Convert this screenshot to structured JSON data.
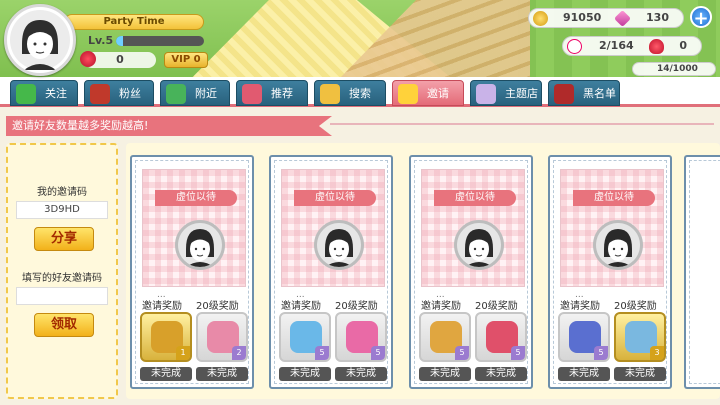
{
  "player": {
    "name": "Party Time",
    "level": "Lv.5",
    "level_progress": 0.08,
    "roses": "0",
    "vip_label": "VIP 0"
  },
  "currency": {
    "coins": "91050",
    "gems": "130",
    "friends": "2/164",
    "hearts": "0",
    "plus_label": "+",
    "partial": "14/1000"
  },
  "tabs": [
    {
      "label": "关注",
      "icon": "follow-arrow-icon",
      "color": "#45b84a"
    },
    {
      "label": "粉丝",
      "icon": "fan-avatar-icon",
      "color": "#c0392b"
    },
    {
      "label": "附近",
      "icon": "map-pin-icon",
      "color": "#48b35a"
    },
    {
      "label": "推荐",
      "icon": "recommend-heart-icon",
      "color": "#e15a70"
    },
    {
      "label": "搜索",
      "icon": "magnifier-icon",
      "color": "#f0c040"
    },
    {
      "label": "邀请",
      "icon": "invite-user-plus-icon",
      "color": "#ffd23a"
    },
    {
      "label": "主题店",
      "icon": "theme-cube-icon",
      "color": "#c9b3e8"
    },
    {
      "label": "黑名单",
      "icon": "blacklist-icon",
      "color": "#b02a2a"
    }
  ],
  "active_tab": "邀请",
  "banner": "邀请好友数量越多奖励越高!",
  "left": {
    "my_code_label": "我的邀请码",
    "my_code": "3D9HD",
    "share_button": "分享",
    "friend_code_label": "填写的好友邀请码",
    "friend_code_value": "",
    "claim_button": "领取"
  },
  "cards": [
    {
      "vacant": "虚位以待",
      "dots": "...",
      "invite_reward": "邀请奖励",
      "level_reward": "20级奖励",
      "rewards": [
        {
          "icon": "treasure-chest-icon",
          "count": "1",
          "style": "gold",
          "color": "#d8a02a"
        },
        {
          "icon": "pink-box-icon",
          "count": "2",
          "style": "",
          "color": "#e88aa8"
        }
      ],
      "status": [
        "未完成",
        "未完成"
      ]
    },
    {
      "vacant": "虚位以待",
      "dots": "...",
      "invite_reward": "邀请奖励",
      "level_reward": "20级奖励",
      "rewards": [
        {
          "icon": "mystery-box-icon",
          "count": "5",
          "style": "",
          "color": "#6ab8e8"
        },
        {
          "icon": "heart-mystery-box-icon",
          "count": "5",
          "style": "",
          "color": "#e96aa6"
        }
      ],
      "status": [
        "未完成",
        "未完成"
      ]
    },
    {
      "vacant": "虚位以待",
      "dots": "...",
      "invite_reward": "邀请奖励",
      "level_reward": "20级奖励",
      "rewards": [
        {
          "icon": "clock-icon",
          "count": "5",
          "style": "",
          "color": "#e0a640"
        },
        {
          "icon": "bow-icon",
          "count": "5",
          "style": "",
          "color": "#e0506a"
        }
      ],
      "status": [
        "未完成",
        "未完成"
      ]
    },
    {
      "vacant": "虚位以待",
      "dots": "...",
      "invite_reward": "邀请奖励",
      "level_reward": "20级奖励",
      "rewards": [
        {
          "icon": "exp-book-icon",
          "count": "5",
          "style": "",
          "color": "#5a6fd0"
        },
        {
          "icon": "potion-drop-icon",
          "count": "3",
          "style": "gold",
          "color": "#7ab8e0"
        }
      ],
      "status": [
        "未完成",
        "未完成"
      ]
    }
  ]
}
